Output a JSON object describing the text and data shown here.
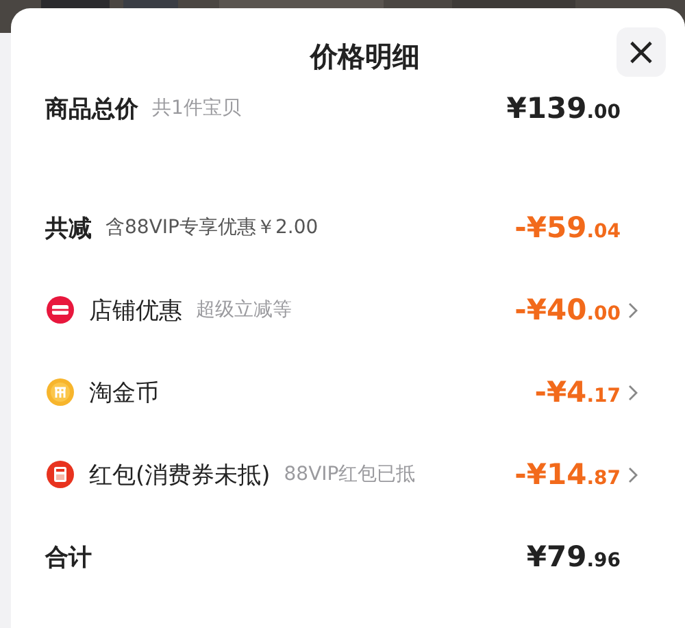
{
  "title": "价格明细",
  "close": "×",
  "rows": [
    {
      "kind": "plain",
      "label": "商品总价",
      "note": "共1件宝贝",
      "amount_main": "¥139",
      "amount_decimal": ".00",
      "discount": false,
      "has_detail": false
    },
    {
      "kind": "plain",
      "label": "共减",
      "note": "含88VIP专享优惠￥2.00",
      "amount_main": "-¥59",
      "amount_decimal": ".04",
      "discount": true,
      "has_detail": false
    },
    {
      "kind": "item",
      "label": "店铺优惠",
      "note": "超级立减等",
      "amount_main": "-¥40",
      "amount_decimal": ".00",
      "discount": true,
      "has_detail": true
    },
    {
      "kind": "item",
      "label": "淘金币",
      "amount_main": "-¥4",
      "amount_decimal": ".17",
      "discount": true,
      "has_detail": true
    },
    {
      "kind": "item",
      "label": "红包(消费券未抵)",
      "note": "88VIP红包已抵",
      "amount_main": "-¥14",
      "amount_decimal": ".87",
      "discount": true,
      "has_detail": true
    },
    {
      "kind": "plain",
      "label": "合计",
      "amount_main": "¥79",
      "amount_decimal": ".96",
      "discount": false,
      "has_detail": false
    }
  ]
}
